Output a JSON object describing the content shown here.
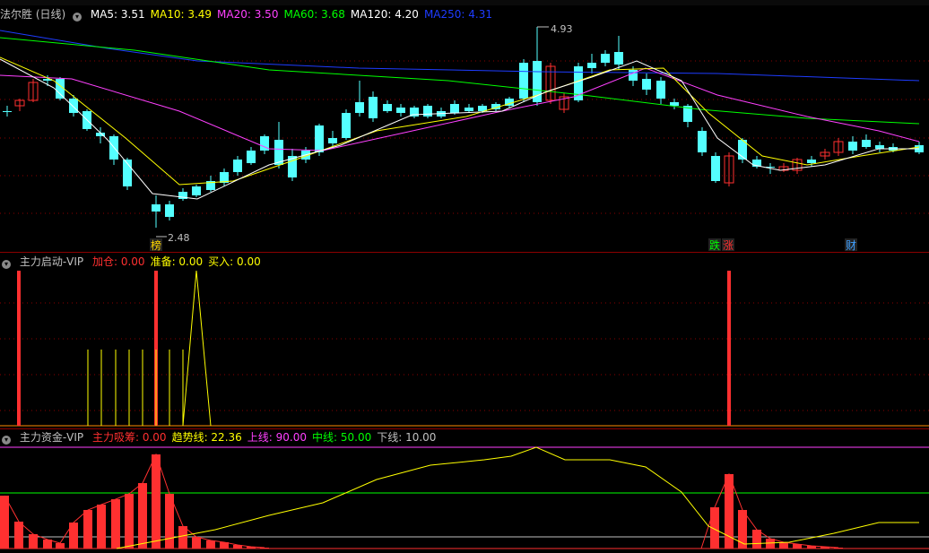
{
  "main": {
    "title": "法尔胜 (日线)",
    "ma_items": [
      {
        "label": "MA5: 3.51",
        "color": "#ffffff"
      },
      {
        "label": "MA10: 3.49",
        "color": "#ffff00"
      },
      {
        "label": "MA20: 3.50",
        "color": "#ff40ff"
      },
      {
        "label": "MA60: 3.68",
        "color": "#00ff00"
      },
      {
        "label": "MA120: 4.20",
        "color": "#ffffff"
      },
      {
        "label": "MA250: 4.31",
        "color": "#1e3cff"
      }
    ],
    "high_label": "4.93",
    "low_label": "2.48",
    "tags": [
      {
        "text": "榜",
        "color": "#ffd700"
      },
      {
        "text": "跌",
        "color": "#00ff00"
      },
      {
        "text": "涨",
        "color": "#ff3030"
      },
      {
        "text": "财",
        "color": "#40a0ff"
      }
    ]
  },
  "indicator1": {
    "name": "主力启动-VIP",
    "items": [
      {
        "label": "加仓: 0.00",
        "color": "#ff3030"
      },
      {
        "label": "准备: 0.00",
        "color": "#ffff00"
      },
      {
        "label": "买入: 0.00",
        "color": "#ffff00"
      }
    ]
  },
  "indicator2": {
    "name": "主力资金-VIP",
    "items": [
      {
        "label": "主力吸筹: 0.00",
        "color": "#ff3030"
      },
      {
        "label": "趋势线: 22.36",
        "color": "#ffff00"
      },
      {
        "label": "上线: 90.00",
        "color": "#ff40ff"
      },
      {
        "label": "中线: 50.00",
        "color": "#00ff00"
      },
      {
        "label": "下线: 10.00",
        "color": "#c0c0c0"
      }
    ]
  },
  "colors": {
    "up": "#ff3030",
    "down": "#54ffff",
    "bg": "#000000",
    "grid": "#8b0000"
  }
}
